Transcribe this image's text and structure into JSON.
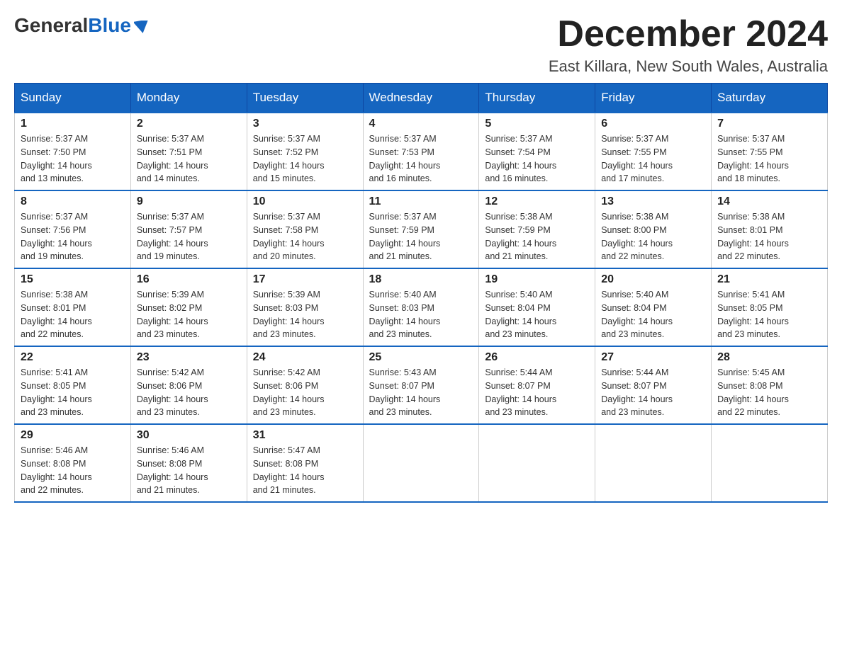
{
  "logo": {
    "general": "General",
    "blue": "Blue"
  },
  "title": {
    "month": "December 2024",
    "location": "East Killara, New South Wales, Australia"
  },
  "days_of_week": [
    "Sunday",
    "Monday",
    "Tuesday",
    "Wednesday",
    "Thursday",
    "Friday",
    "Saturday"
  ],
  "weeks": [
    [
      {
        "day": "1",
        "sunrise": "5:37 AM",
        "sunset": "7:50 PM",
        "daylight": "14 hours and 13 minutes."
      },
      {
        "day": "2",
        "sunrise": "5:37 AM",
        "sunset": "7:51 PM",
        "daylight": "14 hours and 14 minutes."
      },
      {
        "day": "3",
        "sunrise": "5:37 AM",
        "sunset": "7:52 PM",
        "daylight": "14 hours and 15 minutes."
      },
      {
        "day": "4",
        "sunrise": "5:37 AM",
        "sunset": "7:53 PM",
        "daylight": "14 hours and 16 minutes."
      },
      {
        "day": "5",
        "sunrise": "5:37 AM",
        "sunset": "7:54 PM",
        "daylight": "14 hours and 16 minutes."
      },
      {
        "day": "6",
        "sunrise": "5:37 AM",
        "sunset": "7:55 PM",
        "daylight": "14 hours and 17 minutes."
      },
      {
        "day": "7",
        "sunrise": "5:37 AM",
        "sunset": "7:55 PM",
        "daylight": "14 hours and 18 minutes."
      }
    ],
    [
      {
        "day": "8",
        "sunrise": "5:37 AM",
        "sunset": "7:56 PM",
        "daylight": "14 hours and 19 minutes."
      },
      {
        "day": "9",
        "sunrise": "5:37 AM",
        "sunset": "7:57 PM",
        "daylight": "14 hours and 19 minutes."
      },
      {
        "day": "10",
        "sunrise": "5:37 AM",
        "sunset": "7:58 PM",
        "daylight": "14 hours and 20 minutes."
      },
      {
        "day": "11",
        "sunrise": "5:37 AM",
        "sunset": "7:59 PM",
        "daylight": "14 hours and 21 minutes."
      },
      {
        "day": "12",
        "sunrise": "5:38 AM",
        "sunset": "7:59 PM",
        "daylight": "14 hours and 21 minutes."
      },
      {
        "day": "13",
        "sunrise": "5:38 AM",
        "sunset": "8:00 PM",
        "daylight": "14 hours and 22 minutes."
      },
      {
        "day": "14",
        "sunrise": "5:38 AM",
        "sunset": "8:01 PM",
        "daylight": "14 hours and 22 minutes."
      }
    ],
    [
      {
        "day": "15",
        "sunrise": "5:38 AM",
        "sunset": "8:01 PM",
        "daylight": "14 hours and 22 minutes."
      },
      {
        "day": "16",
        "sunrise": "5:39 AM",
        "sunset": "8:02 PM",
        "daylight": "14 hours and 23 minutes."
      },
      {
        "day": "17",
        "sunrise": "5:39 AM",
        "sunset": "8:03 PM",
        "daylight": "14 hours and 23 minutes."
      },
      {
        "day": "18",
        "sunrise": "5:40 AM",
        "sunset": "8:03 PM",
        "daylight": "14 hours and 23 minutes."
      },
      {
        "day": "19",
        "sunrise": "5:40 AM",
        "sunset": "8:04 PM",
        "daylight": "14 hours and 23 minutes."
      },
      {
        "day": "20",
        "sunrise": "5:40 AM",
        "sunset": "8:04 PM",
        "daylight": "14 hours and 23 minutes."
      },
      {
        "day": "21",
        "sunrise": "5:41 AM",
        "sunset": "8:05 PM",
        "daylight": "14 hours and 23 minutes."
      }
    ],
    [
      {
        "day": "22",
        "sunrise": "5:41 AM",
        "sunset": "8:05 PM",
        "daylight": "14 hours and 23 minutes."
      },
      {
        "day": "23",
        "sunrise": "5:42 AM",
        "sunset": "8:06 PM",
        "daylight": "14 hours and 23 minutes."
      },
      {
        "day": "24",
        "sunrise": "5:42 AM",
        "sunset": "8:06 PM",
        "daylight": "14 hours and 23 minutes."
      },
      {
        "day": "25",
        "sunrise": "5:43 AM",
        "sunset": "8:07 PM",
        "daylight": "14 hours and 23 minutes."
      },
      {
        "day": "26",
        "sunrise": "5:44 AM",
        "sunset": "8:07 PM",
        "daylight": "14 hours and 23 minutes."
      },
      {
        "day": "27",
        "sunrise": "5:44 AM",
        "sunset": "8:07 PM",
        "daylight": "14 hours and 23 minutes."
      },
      {
        "day": "28",
        "sunrise": "5:45 AM",
        "sunset": "8:08 PM",
        "daylight": "14 hours and 22 minutes."
      }
    ],
    [
      {
        "day": "29",
        "sunrise": "5:46 AM",
        "sunset": "8:08 PM",
        "daylight": "14 hours and 22 minutes."
      },
      {
        "day": "30",
        "sunrise": "5:46 AM",
        "sunset": "8:08 PM",
        "daylight": "14 hours and 21 minutes."
      },
      {
        "day": "31",
        "sunrise": "5:47 AM",
        "sunset": "8:08 PM",
        "daylight": "14 hours and 21 minutes."
      },
      null,
      null,
      null,
      null
    ]
  ],
  "labels": {
    "sunrise": "Sunrise:",
    "sunset": "Sunset:",
    "daylight": "Daylight:"
  }
}
